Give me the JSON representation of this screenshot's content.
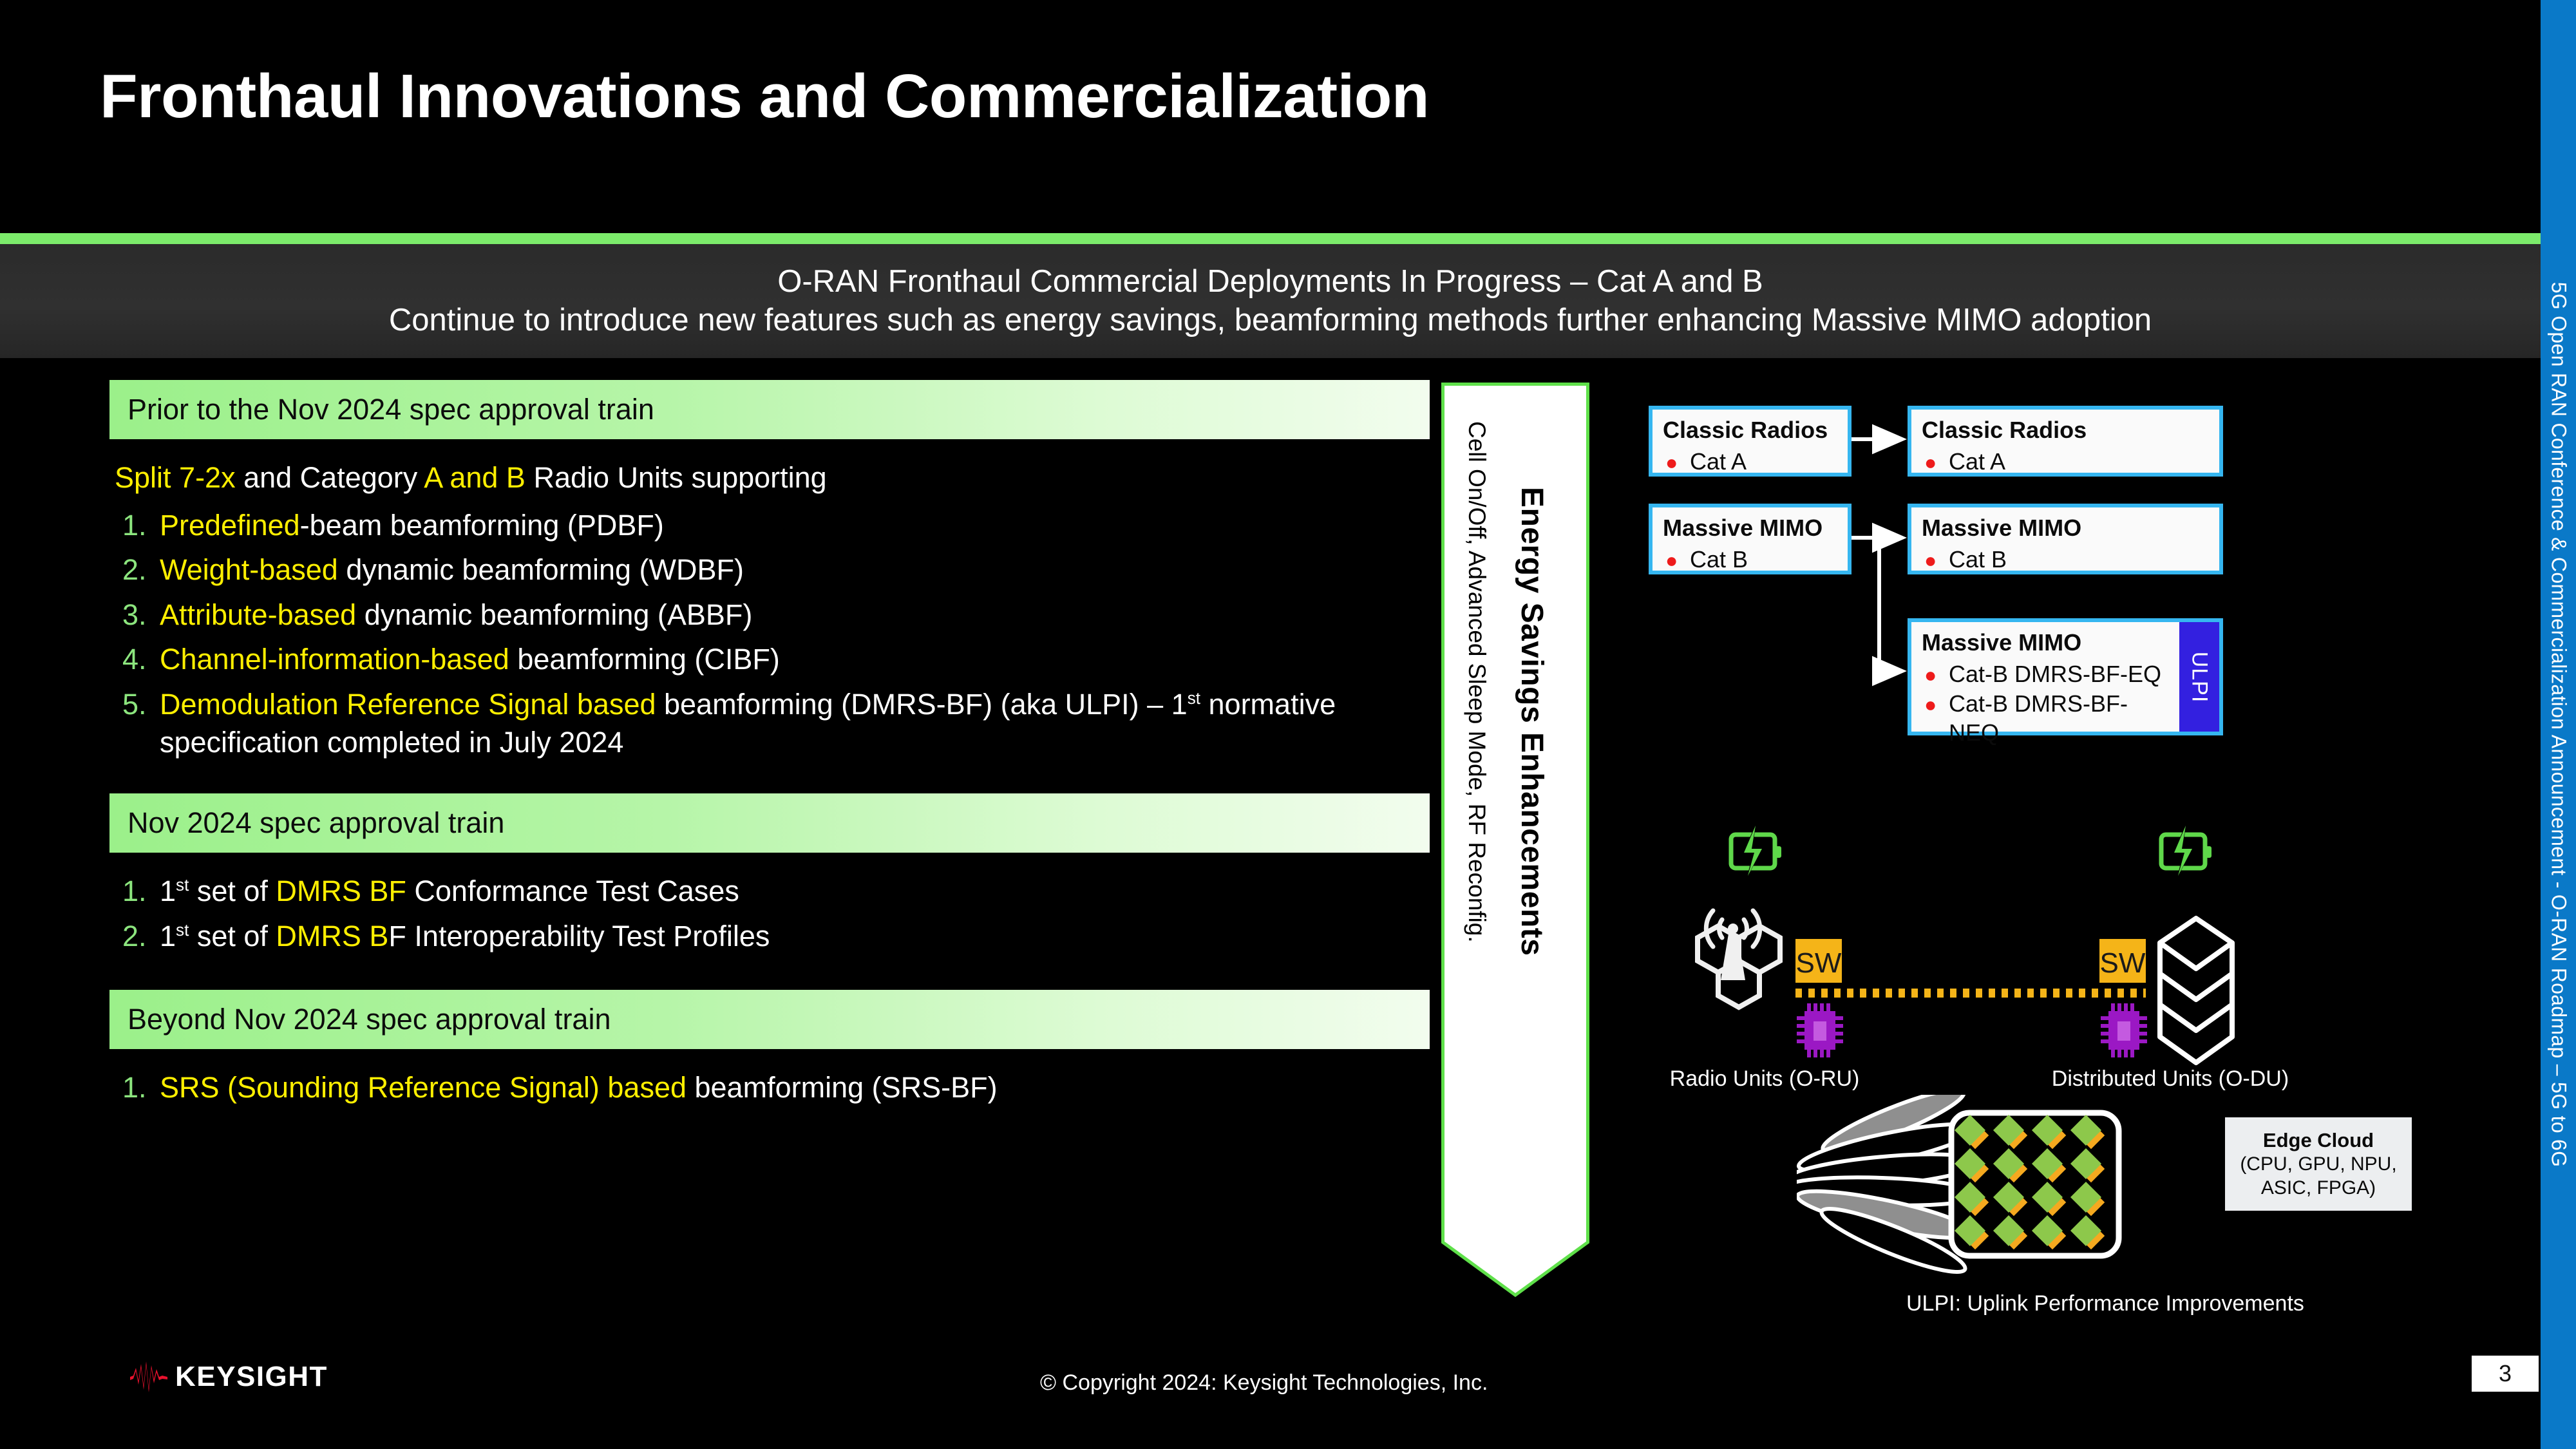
{
  "slide": {
    "title": "Fronthaul Innovations and Commercialization",
    "subtitle_lines": [
      "O-RAN Fronthaul Commercial Deployments In Progress – Cat A and B",
      "Continue to introduce new features such as energy savings, beamforming methods further enhancing Massive MIMO adoption"
    ],
    "page_number": "3"
  },
  "side_rail": {
    "label": "5G Open RAN Conference & Commercialization Announcement - O-RAN Roadmap – 5G to 6G",
    "color": "#0a79c8"
  },
  "colors": {
    "accent_green": "#7ceb6b",
    "bar_green": "#9bf08a",
    "highlight_yellow": "#ffef00",
    "number_green": "#8ce57e",
    "box_blue": "#35b6f0",
    "ulpi_blue": "#3320e0",
    "bullet_red": "#ee1b1b",
    "sw_amber": "#f5b418",
    "chip_purple": "#9b18c4",
    "battery_green": "#5fd84a",
    "keysight_red": "#e8112d"
  },
  "left": {
    "sections": [
      {
        "header": "Prior to the Nov 2024 spec approval train",
        "lead": {
          "parts": [
            {
              "t": "Split 7-2x",
              "hl": true
            },
            {
              "t": " and Category ",
              "hl": false
            },
            {
              "t": "A and B",
              "hl": true
            },
            {
              "t": " Radio Units supporting",
              "hl": false
            }
          ]
        },
        "items": [
          {
            "num": "1.",
            "parts": [
              {
                "t": "Predefined",
                "hl": true
              },
              {
                "t": "-beam beamforming (PDBF)",
                "hl": false
              }
            ]
          },
          {
            "num": "2.",
            "parts": [
              {
                "t": "Weight-based",
                "hl": true
              },
              {
                "t": " dynamic beamforming (WDBF)",
                "hl": false
              }
            ]
          },
          {
            "num": "3.",
            "parts": [
              {
                "t": "Attribute-based",
                "hl": true
              },
              {
                "t": " dynamic beamforming (ABBF)",
                "hl": false
              }
            ]
          },
          {
            "num": "4.",
            "parts": [
              {
                "t": "Channel-information-based",
                "hl": true
              },
              {
                "t": " beamforming (CIBF)",
                "hl": false
              }
            ]
          },
          {
            "num": "5.",
            "parts": [
              {
                "t": "Demodulation Reference Signal based",
                "hl": true
              },
              {
                "t": " beamforming (DMRS-BF) (aka ULPI) – 1",
                "hl": false
              },
              {
                "t": "st",
                "hl": false,
                "sup": true
              },
              {
                "t": " normative specification completed in July 2024",
                "hl": false
              }
            ]
          }
        ]
      },
      {
        "header": "Nov 2024 spec approval train",
        "items": [
          {
            "num": "1.",
            "parts": [
              {
                "t": "1",
                "hl": false
              },
              {
                "t": "st",
                "hl": false,
                "sup": true
              },
              {
                "t": " set of ",
                "hl": false
              },
              {
                "t": "DMRS BF",
                "hl": true
              },
              {
                "t": " Conformance Test Cases",
                "hl": false
              }
            ]
          },
          {
            "num": "2.",
            "parts": [
              {
                "t": "1",
                "hl": false
              },
              {
                "t": "st",
                "hl": false,
                "sup": true
              },
              {
                "t": " set of ",
                "hl": false
              },
              {
                "t": "DMRS B",
                "hl": true
              },
              {
                "t": "F Interoperability Test Profiles",
                "hl": false
              }
            ]
          }
        ]
      },
      {
        "header": "Beyond Nov 2024 spec approval train",
        "items": [
          {
            "num": "1.",
            "parts": [
              {
                "t": "SRS (Sounding Reference Signal) based",
                "hl": true
              },
              {
                "t": " beamforming (SRS-BF)",
                "hl": false
              }
            ]
          }
        ]
      }
    ]
  },
  "energy_arrow": {
    "title": "Energy Savings Enhancements",
    "subtitle": "Cell On/Off, Advanced Sleep Mode, RF Reconfig."
  },
  "diagram": {
    "boxes": [
      {
        "id": "classic-left",
        "title": "Classic Radios",
        "bullets": [
          "Cat A"
        ],
        "ulpi": false
      },
      {
        "id": "classic-right",
        "title": "Classic Radios",
        "bullets": [
          "Cat A"
        ],
        "ulpi": false
      },
      {
        "id": "mimo-left",
        "title": "Massive MIMO",
        "bullets": [
          "Cat B"
        ],
        "ulpi": false
      },
      {
        "id": "mimo-right",
        "title": "Massive MIMO",
        "bullets": [
          "Cat B"
        ],
        "ulpi": false
      },
      {
        "id": "mimo-ulpi",
        "title": "Massive MIMO",
        "bullets": [
          "Cat-B DMRS-BF-EQ",
          "Cat-B DMRS-BF-NEQ"
        ],
        "ulpi": true,
        "ulpi_label": "ULPI"
      }
    ]
  },
  "network": {
    "sw_label": "SW",
    "captions": {
      "radio_units": "Radio Units (O-RU)",
      "distributed_units": "Distributed Units (O-DU)"
    }
  },
  "edge_cloud": {
    "title": "Edge Cloud",
    "lines": [
      "(CPU, GPU, NPU,",
      "ASIC, FPGA)"
    ]
  },
  "legend": {
    "ulpi": "ULPI: Uplink Performance Improvements"
  },
  "footer": {
    "brand": "KEYSIGHT",
    "copyright": "© Copyright 2024: Keysight Technologies, Inc."
  }
}
